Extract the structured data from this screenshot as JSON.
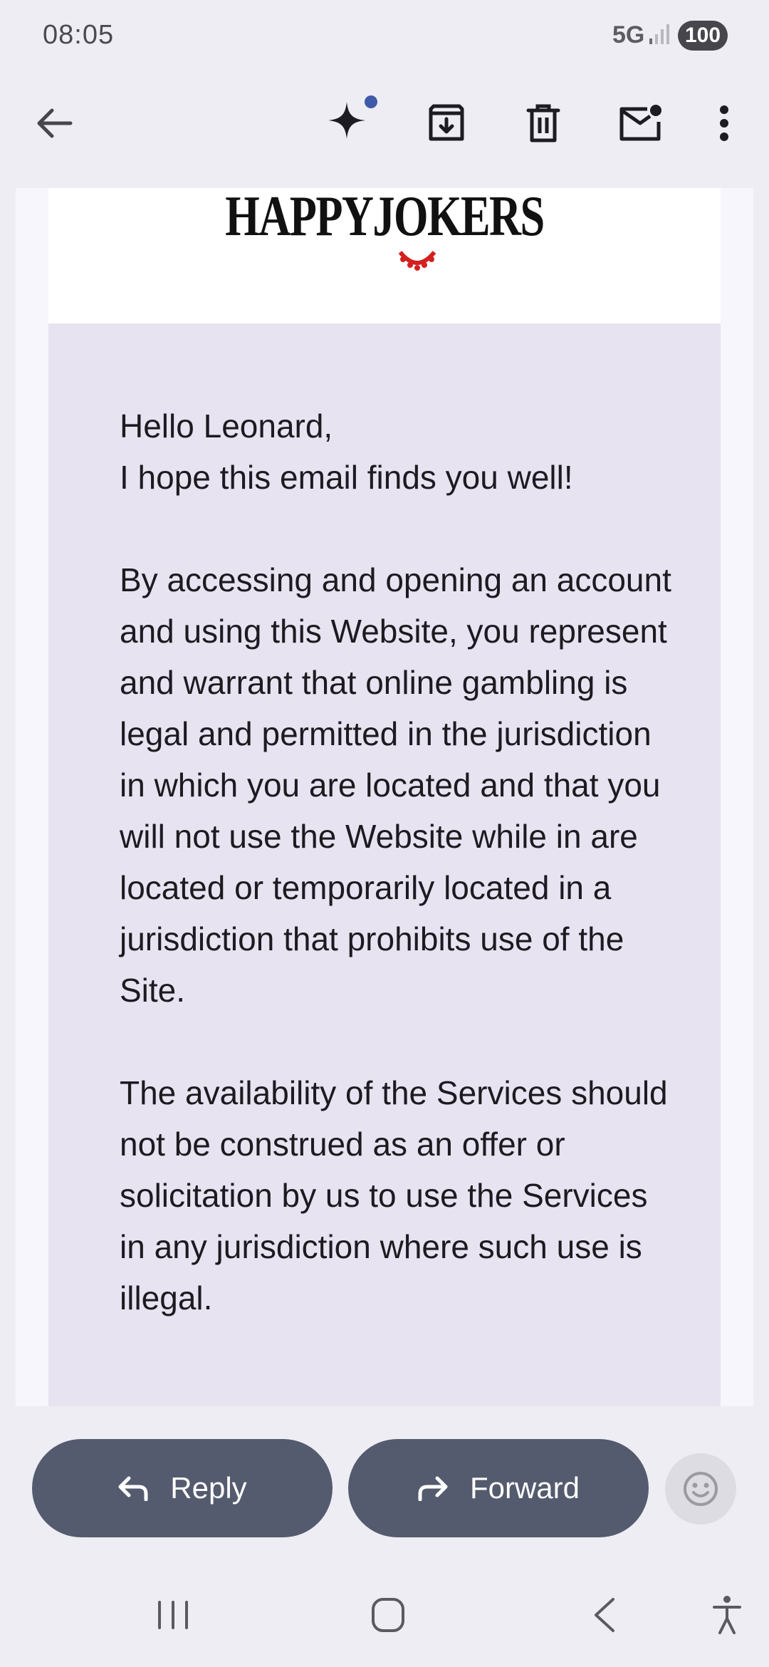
{
  "status_bar": {
    "time": "08:05",
    "network": "5G",
    "battery": "100"
  },
  "toolbar": {
    "back_icon": "arrow-left-icon",
    "gemini_icon": "sparkle-icon",
    "archive_icon": "archive-icon",
    "delete_icon": "trash-icon",
    "mark_unread_icon": "mail-unread-icon",
    "more_icon": "more-vert-icon"
  },
  "email": {
    "logo_text": "HAPPYJOKERS",
    "greeting": "Hello Leonard,",
    "intro": "I hope this email finds you well!",
    "paragraph1": "By accessing and opening an account and using this Website, you represent and warrant that online gambling is legal and permitted in the jurisdiction in which you are located and that you will not use the Website while in are located or temporarily located in a jurisdiction that prohibits use of the Site.",
    "paragraph2": "The availability of the Services should not be construed as an offer or solicitation by us to use the Services in any jurisdiction where such use is illegal."
  },
  "actions": {
    "reply_label": "Reply",
    "forward_label": "Forward",
    "emoji_icon": "smiley-icon"
  },
  "nav": {
    "recents_icon": "recents-icon",
    "home_icon": "home-icon",
    "back_icon": "nav-back-icon",
    "accessibility_icon": "accessibility-icon"
  },
  "colors": {
    "background": "#eeedf4",
    "content_panel": "#e8e3f1",
    "button": "#555b6e",
    "badge_dot": "#3f5aa8"
  }
}
